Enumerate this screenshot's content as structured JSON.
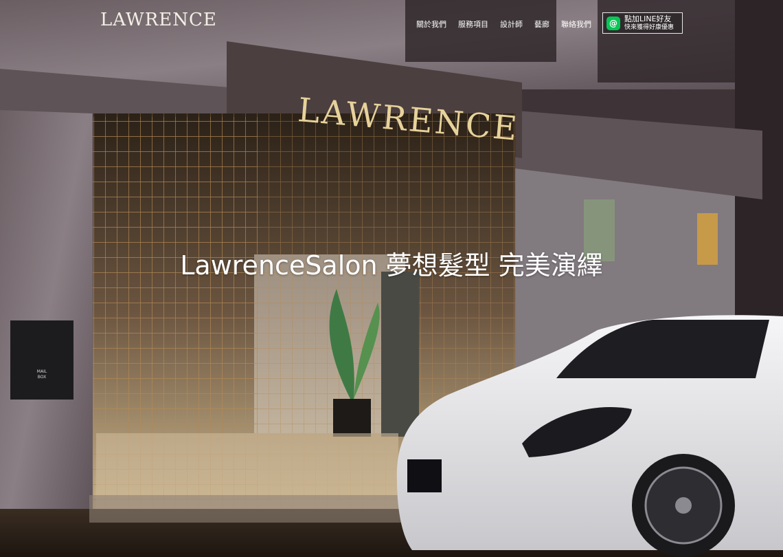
{
  "logo": "LAWRENCE",
  "nav": {
    "items": [
      {
        "label": "關於我們"
      },
      {
        "label": "服務項目"
      },
      {
        "label": "設計師"
      },
      {
        "label": "藝廊"
      },
      {
        "label": "聯絡我們"
      }
    ]
  },
  "line_button": {
    "icon": "line-icon",
    "line1": "點加LINE好友",
    "line2": "快來獲得好康優惠"
  },
  "hero": {
    "headline": "LawrenceSalon 夢想髮型 完美演繹",
    "sign_text": "LAWRENCE",
    "mailbox_text_1": "MAIL",
    "mailbox_text_2": "BOX"
  },
  "colors": {
    "line_green": "#06c755",
    "text_white": "#ffffff"
  }
}
